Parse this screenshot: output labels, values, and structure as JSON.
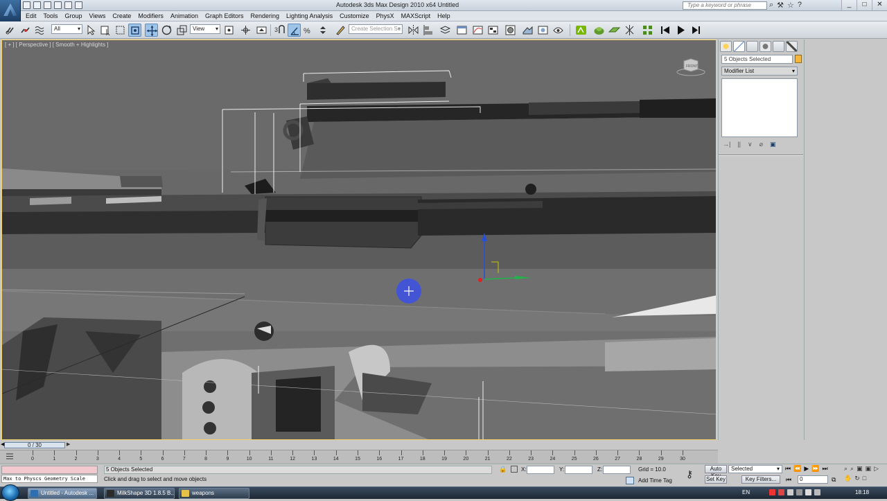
{
  "window": {
    "title": "Autodesk 3ds Max Design 2010 x64      Untitled",
    "help_search_placeholder": "Type a keyword or phrase",
    "controls": [
      "_",
      "□",
      "✕"
    ]
  },
  "menu": [
    "Edit",
    "Tools",
    "Group",
    "Views",
    "Create",
    "Modifiers",
    "Animation",
    "Graph Editors",
    "Rendering",
    "Lighting Analysis",
    "Customize",
    "PhysX",
    "MAXScript",
    "Help"
  ],
  "toolbar": {
    "selection_filter": "All",
    "reference_coord": "View",
    "named_selection_placeholder": "Create Selection Se"
  },
  "viewport": {
    "label": "[ + ] [ Perspective ] [ Smooth + Highlights ]",
    "viewcube_face": "FRONT"
  },
  "command_panel": {
    "selection_name": "5 Objects Selected",
    "selection_color": "#f4b63b",
    "modifier_list": "Modifier List",
    "stack_tools": [
      "→|",
      "||",
      "∨",
      "⌀",
      "▣"
    ]
  },
  "timeline": {
    "slider_label": "0 / 30",
    "ticks": [
      "0",
      "1",
      "2",
      "3",
      "4",
      "5",
      "6",
      "7",
      "8",
      "9",
      "10",
      "11",
      "12",
      "13",
      "14",
      "15",
      "16",
      "17",
      "18",
      "19",
      "20",
      "21",
      "22",
      "23",
      "24",
      "25",
      "26",
      "27",
      "28",
      "29",
      "30"
    ]
  },
  "status": {
    "maxscript_listener": "Max to Physcs Geometry Scale",
    "selection_info": "5 Objects Selected",
    "prompt": "Click and drag to select and move objects",
    "x_label": "X:",
    "y_label": "Y:",
    "z_label": "Z:",
    "grid": "Grid = 10.0",
    "add_time_tag": "Add Time Tag",
    "auto_key": "Auto Key",
    "set_key": "Set Key",
    "key_mode": "Selected",
    "key_filters": "Key Filters...",
    "current_frame": "0"
  },
  "taskbar": {
    "tasks": [
      {
        "label": "Untitled - Autodesk ...",
        "icon_color": "#2f6fb0",
        "active": true
      },
      {
        "label": "MilkShape 3D 1.8.5 B...",
        "icon_color": "#2b2b2b",
        "active": false
      },
      {
        "label": "weapons",
        "icon_color": "#e7c24a",
        "active": false
      }
    ],
    "language": "EN",
    "clock": "18:18"
  }
}
